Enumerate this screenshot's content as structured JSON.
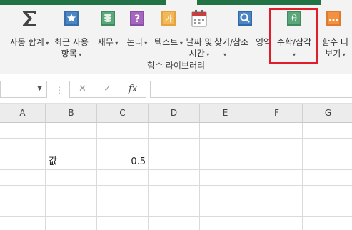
{
  "ribbon": {
    "buttons": [
      {
        "name": "autosum-button",
        "icon": "sigma-icon",
        "line1": "자동 합계",
        "line2": "",
        "caret": true
      },
      {
        "name": "recently-used-button",
        "icon": "star-book-icon",
        "line1": "최근 사용",
        "line2": "항목",
        "caret": true
      },
      {
        "name": "financial-button",
        "icon": "money-book-icon",
        "line1": "재무",
        "line2": "",
        "caret": true
      },
      {
        "name": "logical-button",
        "icon": "question-book-icon",
        "line1": "논리",
        "line2": "",
        "caret": true
      },
      {
        "name": "text-button",
        "icon": "ga-book-icon",
        "line1": "텍스트",
        "line2": "",
        "caret": true
      },
      {
        "name": "date-time-button",
        "icon": "calendar-book-icon",
        "line1": "날짜 및",
        "line2": "시간",
        "caret": true
      },
      {
        "name": "lookup-reference-button",
        "icon": "magnifier-book-icon",
        "line1": "찾기/참조",
        "line2": "",
        "caret": true
      },
      {
        "name": "math-trig-button",
        "icon": "theta-book-icon",
        "line1": "수학/삼각",
        "line2": "",
        "caret": true
      },
      {
        "name": "more-functions-button",
        "icon": "dots-book-icon",
        "line1": "함수 더",
        "line2": "보기",
        "caret": true
      }
    ],
    "partial_label": "영역",
    "group_label": "함수 라이브러리",
    "highlight_color": "#e01e2b"
  },
  "formula_bar": {
    "cancel_symbol": "✕",
    "enter_symbol": "✓",
    "fx_symbol": "fx",
    "value": ""
  },
  "sheet": {
    "columns": [
      "A",
      "B",
      "C",
      "D",
      "E",
      "F",
      "G"
    ],
    "cells": {
      "B3": "값",
      "C3": "0.5"
    }
  },
  "colors": {
    "title_green": "#217346",
    "ribbon_bg": "#f3f3f3"
  }
}
